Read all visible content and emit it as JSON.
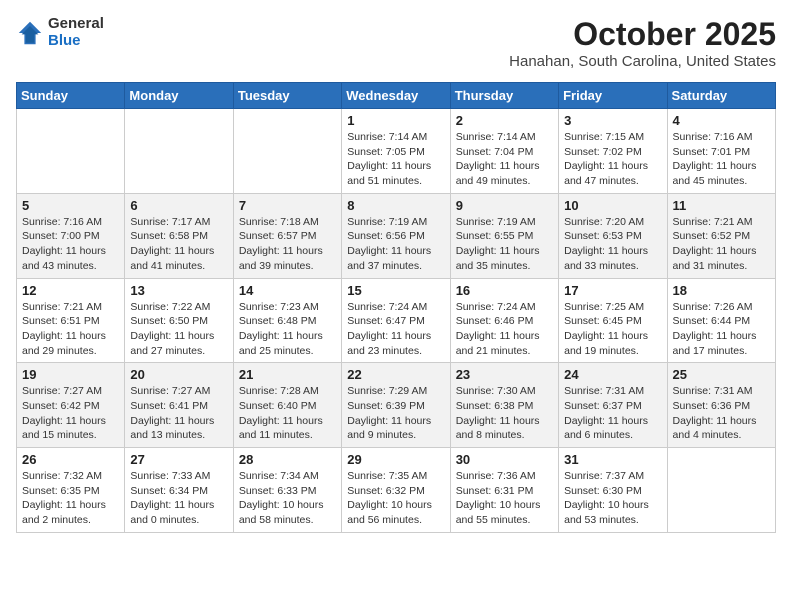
{
  "logo": {
    "general": "General",
    "blue": "Blue"
  },
  "header": {
    "month": "October 2025",
    "location": "Hanahan, South Carolina, United States"
  },
  "weekdays": [
    "Sunday",
    "Monday",
    "Tuesday",
    "Wednesday",
    "Thursday",
    "Friday",
    "Saturday"
  ],
  "weeks": [
    [
      {
        "day": "",
        "info": ""
      },
      {
        "day": "",
        "info": ""
      },
      {
        "day": "",
        "info": ""
      },
      {
        "day": "1",
        "info": "Sunrise: 7:14 AM\nSunset: 7:05 PM\nDaylight: 11 hours\nand 51 minutes."
      },
      {
        "day": "2",
        "info": "Sunrise: 7:14 AM\nSunset: 7:04 PM\nDaylight: 11 hours\nand 49 minutes."
      },
      {
        "day": "3",
        "info": "Sunrise: 7:15 AM\nSunset: 7:02 PM\nDaylight: 11 hours\nand 47 minutes."
      },
      {
        "day": "4",
        "info": "Sunrise: 7:16 AM\nSunset: 7:01 PM\nDaylight: 11 hours\nand 45 minutes."
      }
    ],
    [
      {
        "day": "5",
        "info": "Sunrise: 7:16 AM\nSunset: 7:00 PM\nDaylight: 11 hours\nand 43 minutes."
      },
      {
        "day": "6",
        "info": "Sunrise: 7:17 AM\nSunset: 6:58 PM\nDaylight: 11 hours\nand 41 minutes."
      },
      {
        "day": "7",
        "info": "Sunrise: 7:18 AM\nSunset: 6:57 PM\nDaylight: 11 hours\nand 39 minutes."
      },
      {
        "day": "8",
        "info": "Sunrise: 7:19 AM\nSunset: 6:56 PM\nDaylight: 11 hours\nand 37 minutes."
      },
      {
        "day": "9",
        "info": "Sunrise: 7:19 AM\nSunset: 6:55 PM\nDaylight: 11 hours\nand 35 minutes."
      },
      {
        "day": "10",
        "info": "Sunrise: 7:20 AM\nSunset: 6:53 PM\nDaylight: 11 hours\nand 33 minutes."
      },
      {
        "day": "11",
        "info": "Sunrise: 7:21 AM\nSunset: 6:52 PM\nDaylight: 11 hours\nand 31 minutes."
      }
    ],
    [
      {
        "day": "12",
        "info": "Sunrise: 7:21 AM\nSunset: 6:51 PM\nDaylight: 11 hours\nand 29 minutes."
      },
      {
        "day": "13",
        "info": "Sunrise: 7:22 AM\nSunset: 6:50 PM\nDaylight: 11 hours\nand 27 minutes."
      },
      {
        "day": "14",
        "info": "Sunrise: 7:23 AM\nSunset: 6:48 PM\nDaylight: 11 hours\nand 25 minutes."
      },
      {
        "day": "15",
        "info": "Sunrise: 7:24 AM\nSunset: 6:47 PM\nDaylight: 11 hours\nand 23 minutes."
      },
      {
        "day": "16",
        "info": "Sunrise: 7:24 AM\nSunset: 6:46 PM\nDaylight: 11 hours\nand 21 minutes."
      },
      {
        "day": "17",
        "info": "Sunrise: 7:25 AM\nSunset: 6:45 PM\nDaylight: 11 hours\nand 19 minutes."
      },
      {
        "day": "18",
        "info": "Sunrise: 7:26 AM\nSunset: 6:44 PM\nDaylight: 11 hours\nand 17 minutes."
      }
    ],
    [
      {
        "day": "19",
        "info": "Sunrise: 7:27 AM\nSunset: 6:42 PM\nDaylight: 11 hours\nand 15 minutes."
      },
      {
        "day": "20",
        "info": "Sunrise: 7:27 AM\nSunset: 6:41 PM\nDaylight: 11 hours\nand 13 minutes."
      },
      {
        "day": "21",
        "info": "Sunrise: 7:28 AM\nSunset: 6:40 PM\nDaylight: 11 hours\nand 11 minutes."
      },
      {
        "day": "22",
        "info": "Sunrise: 7:29 AM\nSunset: 6:39 PM\nDaylight: 11 hours\nand 9 minutes."
      },
      {
        "day": "23",
        "info": "Sunrise: 7:30 AM\nSunset: 6:38 PM\nDaylight: 11 hours\nand 8 minutes."
      },
      {
        "day": "24",
        "info": "Sunrise: 7:31 AM\nSunset: 6:37 PM\nDaylight: 11 hours\nand 6 minutes."
      },
      {
        "day": "25",
        "info": "Sunrise: 7:31 AM\nSunset: 6:36 PM\nDaylight: 11 hours\nand 4 minutes."
      }
    ],
    [
      {
        "day": "26",
        "info": "Sunrise: 7:32 AM\nSunset: 6:35 PM\nDaylight: 11 hours\nand 2 minutes."
      },
      {
        "day": "27",
        "info": "Sunrise: 7:33 AM\nSunset: 6:34 PM\nDaylight: 11 hours\nand 0 minutes."
      },
      {
        "day": "28",
        "info": "Sunrise: 7:34 AM\nSunset: 6:33 PM\nDaylight: 10 hours\nand 58 minutes."
      },
      {
        "day": "29",
        "info": "Sunrise: 7:35 AM\nSunset: 6:32 PM\nDaylight: 10 hours\nand 56 minutes."
      },
      {
        "day": "30",
        "info": "Sunrise: 7:36 AM\nSunset: 6:31 PM\nDaylight: 10 hours\nand 55 minutes."
      },
      {
        "day": "31",
        "info": "Sunrise: 7:37 AM\nSunset: 6:30 PM\nDaylight: 10 hours\nand 53 minutes."
      },
      {
        "day": "",
        "info": ""
      }
    ]
  ]
}
